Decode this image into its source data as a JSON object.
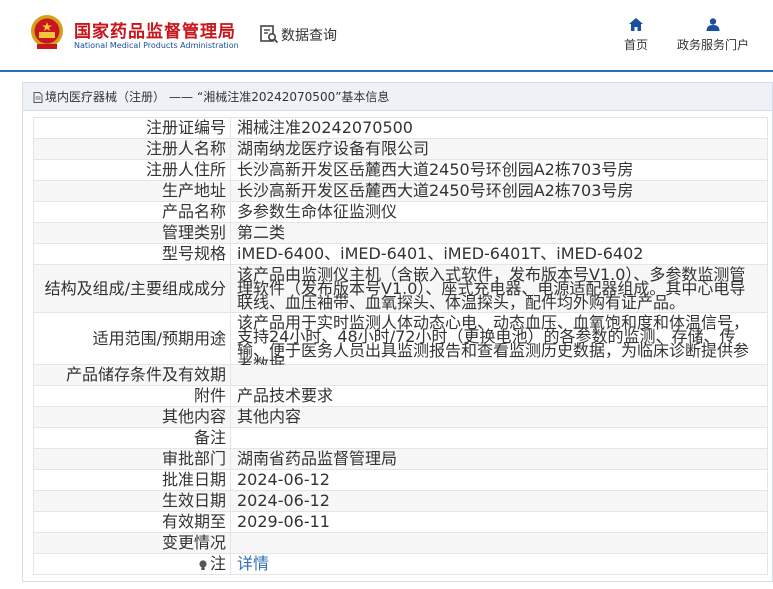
{
  "header": {
    "site_name_cn": "国家药品监督管理局",
    "site_name_en": "National Medical Products Administration",
    "query_label": "数据查询",
    "nav": [
      {
        "label": "首页",
        "icon": "home-icon"
      },
      {
        "label": "政务服务门户",
        "icon": "user-icon"
      }
    ]
  },
  "breadcrumb": {
    "category": "境内医疗器械（注册）",
    "separator": "——",
    "record": "“湘械注准20242070500”基本信息"
  },
  "record": {
    "rows": [
      {
        "label": "注册证编号",
        "value": "湘械注准20242070500"
      },
      {
        "label": "注册人名称",
        "value": "湖南纳龙医疗设备有限公司"
      },
      {
        "label": "注册人住所",
        "value": "长沙高新开发区岳麓西大道2450号环创园A2栋703号房"
      },
      {
        "label": "生产地址",
        "value": "长沙高新开发区岳麓西大道2450号环创园A2栋703号房"
      },
      {
        "label": "产品名称",
        "value": "多参数生命体征监测仪"
      },
      {
        "label": "管理类别",
        "value": "第二类"
      },
      {
        "label": "型号规格",
        "value": "iMED-6400、iMED-6401、iMED-6401T、iMED-6402"
      },
      {
        "label": "结构及组成/主要组成成分",
        "value": "该产品由监测仪主机（含嵌入式软件，发布版本号V1.0）、多参数监测管理软件（发布版本号V1.0）、座式充电器、电源适配器组成。其中心电导联线、血压袖带、血氧探头、体温探头，配件均外购有证产品。"
      },
      {
        "label": "适用范围/预期用途",
        "value": "该产品用于实时监测人体动态心电、动态血压、血氧饱和度和体温信号，支持24小时、48小时/72小时（更换电池）的各参数的监测、存储、传输、便于医务人员出具监测报告和查看监测历史数据，为临床诊断提供参考数据。"
      },
      {
        "label": "产品储存条件及有效期",
        "value": ""
      },
      {
        "label": "附件",
        "value": "产品技术要求"
      },
      {
        "label": "其他内容",
        "value": "其他内容"
      },
      {
        "label": "备注",
        "value": ""
      },
      {
        "label": "审批部门",
        "value": "湖南省药品监督管理局"
      },
      {
        "label": "批准日期",
        "value": "2024-06-12"
      },
      {
        "label": "生效日期",
        "value": "2024-06-12"
      },
      {
        "label": "有效期至",
        "value": "2029-06-11"
      },
      {
        "label": "变更情况",
        "value": ""
      },
      {
        "label": "注",
        "value": "详情"
      }
    ]
  },
  "colors": {
    "brand_red": "#c8161d",
    "brand_blue": "#1a4f9c",
    "link_blue": "#2d6fb5"
  }
}
